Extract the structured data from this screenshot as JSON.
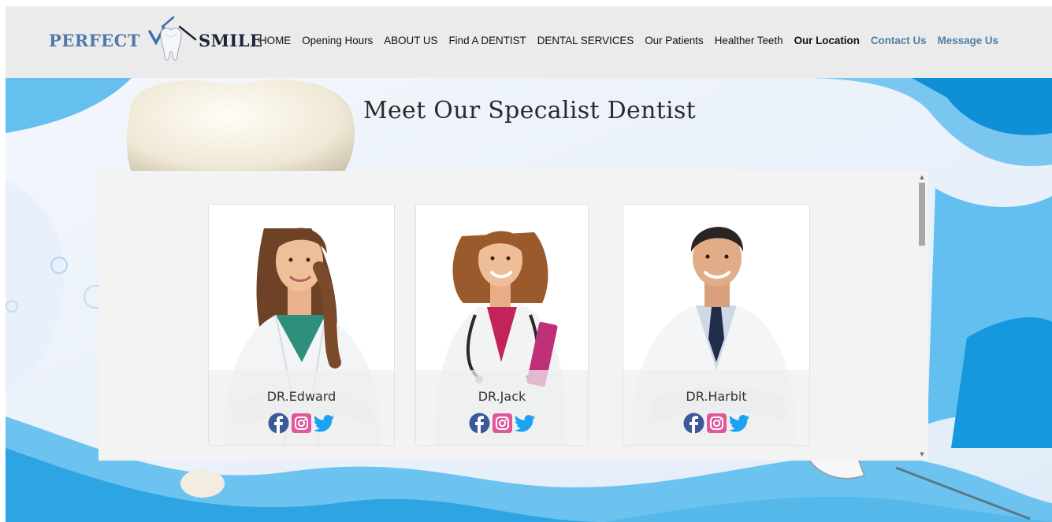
{
  "logo": {
    "left_word": "PERFECT",
    "right_word": "SMILE"
  },
  "nav": {
    "home": "HOME",
    "opening_hours": "Opening Hours",
    "about_us": "ABOUT US",
    "find_dentist": "Find A DENTIST",
    "dental_services": "DENTAL SERVICES",
    "our_patients": "Our Patients",
    "healther_teeth": "Healther Teeth",
    "our_location": "Our Location",
    "contact_us": "Contact Us",
    "message_us": "Message Us"
  },
  "hero": {
    "title": "Meet Our Specalist Dentist"
  },
  "dentists": [
    {
      "name": "DR.Edward"
    },
    {
      "name": "DR.Jack"
    },
    {
      "name": "DR.Harbit"
    }
  ],
  "colors": {
    "header_bg": "#ebebeb",
    "logo_blue": "#4f7aa6",
    "nav_blue": "#4e7fa6",
    "hero_light": "#e8f1fb",
    "hero_blue": "#5bb7ea",
    "facebook": "#3b5998",
    "instagram": "#e1579d",
    "twitter": "#1da1f2"
  },
  "icons": {
    "logo_tooth": "tooth-icon",
    "facebook": "facebook-icon",
    "instagram": "instagram-icon",
    "twitter": "twitter-icon"
  }
}
